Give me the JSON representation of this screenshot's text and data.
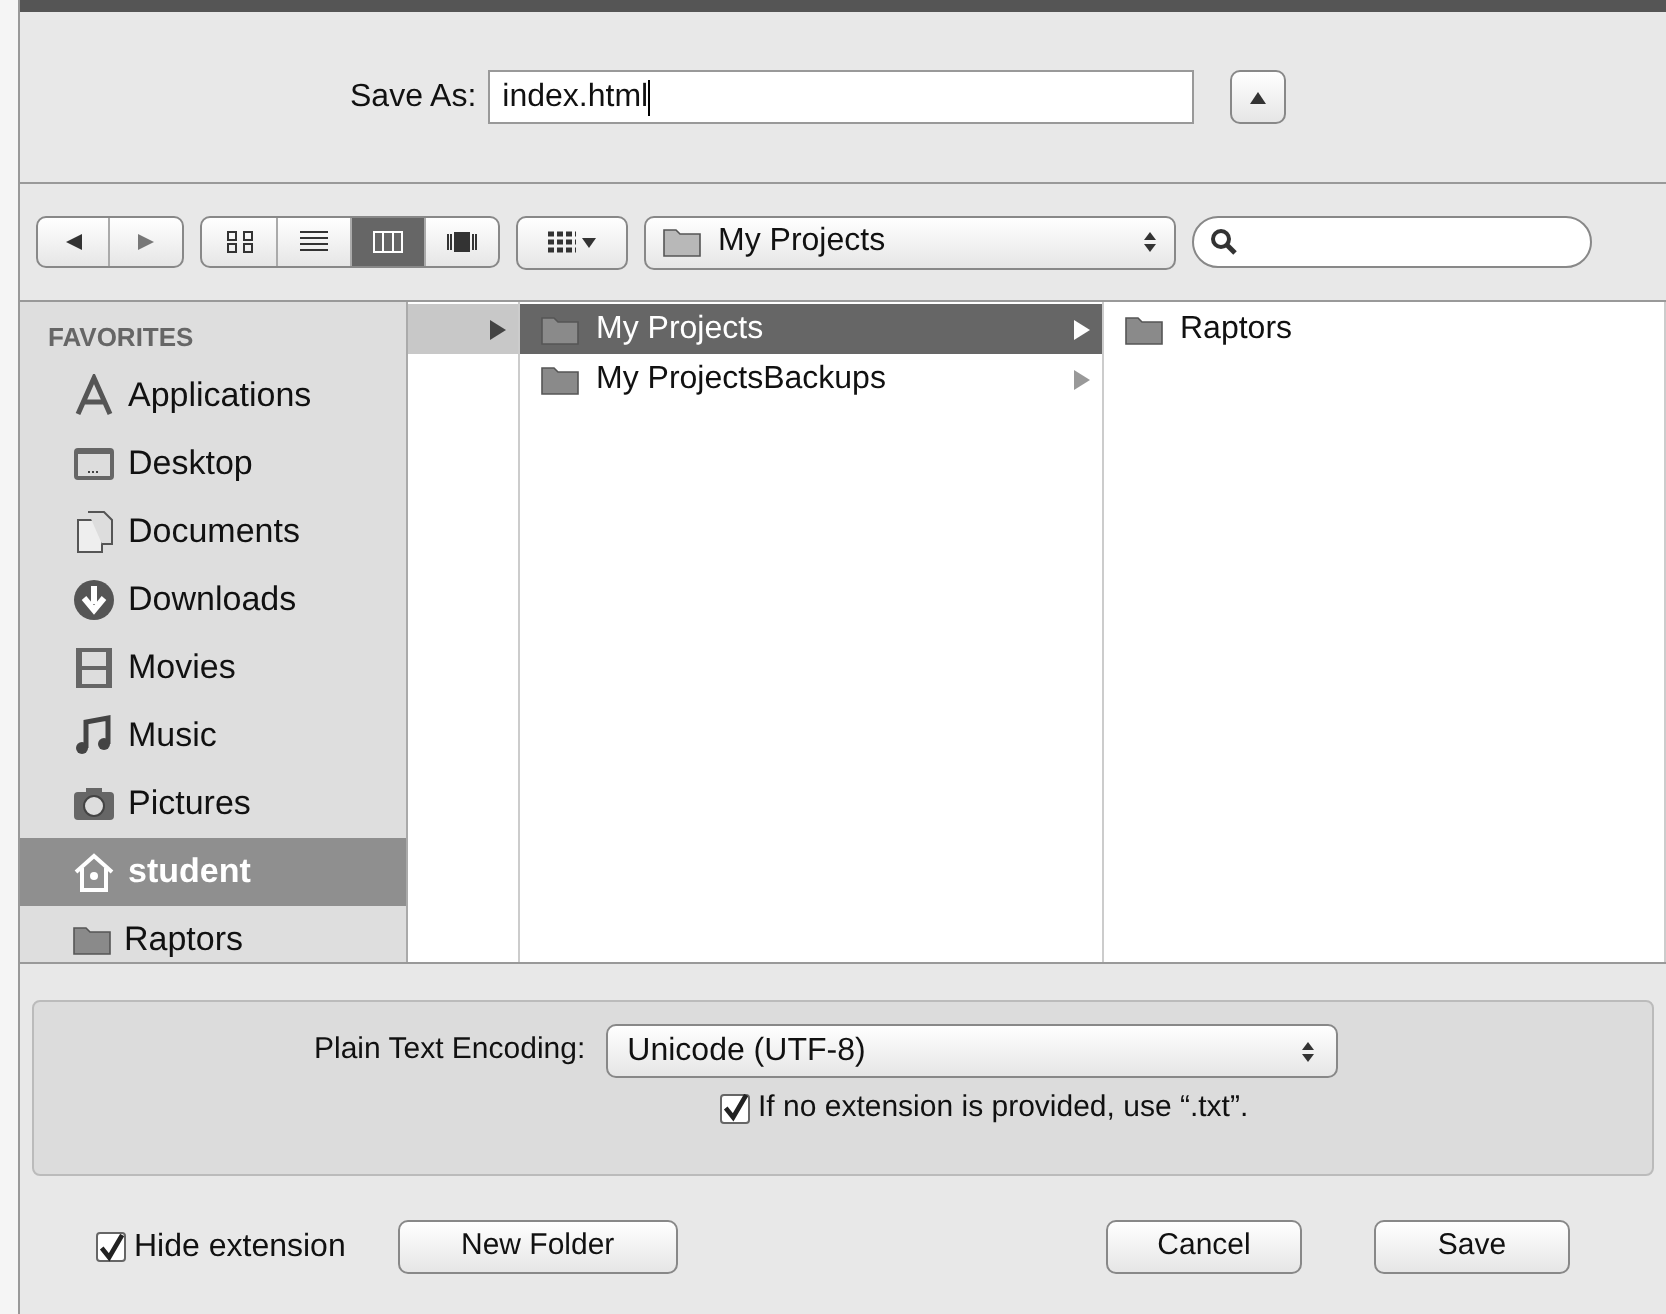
{
  "save_as": {
    "label": "Save As:",
    "value": "index.html",
    "expanded": true
  },
  "toolbar": {
    "view_modes": [
      {
        "kind": "icons",
        "selected": false
      },
      {
        "kind": "list",
        "selected": false
      },
      {
        "kind": "columns",
        "selected": true
      },
      {
        "kind": "coverflow",
        "selected": false
      }
    ],
    "location": "My Projects"
  },
  "sidebar": {
    "heading": "FAVORITES",
    "items": [
      {
        "kind": "applications",
        "label": "Applications",
        "selected": false
      },
      {
        "kind": "desktop",
        "label": "Desktop",
        "selected": false
      },
      {
        "kind": "documents",
        "label": "Documents",
        "selected": false
      },
      {
        "kind": "downloads",
        "label": "Downloads",
        "selected": false
      },
      {
        "kind": "movies",
        "label": "Movies",
        "selected": false
      },
      {
        "kind": "music",
        "label": "Music",
        "selected": false
      },
      {
        "kind": "pictures",
        "label": "Pictures",
        "selected": false
      },
      {
        "kind": "home",
        "label": "student",
        "selected": true
      },
      {
        "kind": "folder",
        "label": "Raptors",
        "selected": false
      }
    ]
  },
  "columns": [
    {
      "items": [
        {
          "selected": true,
          "has_children": true
        }
      ]
    },
    {
      "items": [
        {
          "label": "My Projects",
          "selected": true,
          "has_children": true
        },
        {
          "label": "My ProjectsBackups",
          "selected": false,
          "has_children": true
        }
      ]
    },
    {
      "items": [
        {
          "label": "Raptors",
          "selected": false,
          "has_children": false
        }
      ]
    }
  ],
  "options": {
    "encoding_label": "Plain Text Encoding:",
    "encoding": "Unicode (UTF-8)",
    "default_ext": {
      "label": "If no extension is provided, use “.txt”.",
      "checked": true
    }
  },
  "footer": {
    "hide_extension": {
      "label": "Hide extension",
      "checked": true
    },
    "new_folder": "New Folder",
    "cancel": "Cancel",
    "save": "Save"
  }
}
